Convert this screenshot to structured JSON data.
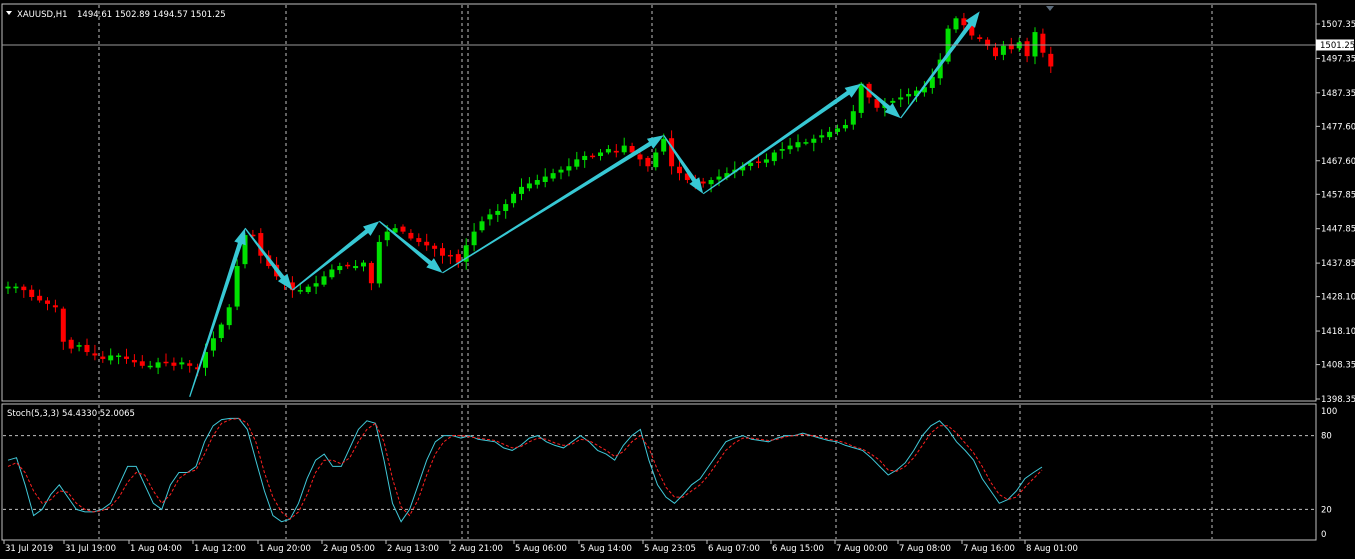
{
  "chart_data": {
    "type": "candlestick",
    "symbol_header": "XAUUSD,H1",
    "ohlc_header": "1494.61 1502.89 1494.57 1501.25",
    "current_price_label": "1501.25",
    "current_price": 1501.25,
    "price_axis": {
      "ylim": [
        1398.35,
        1512.0
      ],
      "ticks": [
        "1507.35",
        "1497.35",
        "1487.35",
        "1477.60",
        "1467.60",
        "1457.85",
        "1447.85",
        "1437.85",
        "1428.10",
        "1418.10",
        "1408.35",
        "1398.35"
      ]
    },
    "time_axis": {
      "labels": [
        "31 Jul 2019",
        "31 Jul 19:00",
        "1 Aug 04:00",
        "1 Aug 12:00",
        "1 Aug 20:00",
        "2 Aug 05:00",
        "2 Aug 13:00",
        "2 Aug 21:00",
        "5 Aug 06:00",
        "5 Aug 14:00",
        "5 Aug 23:05",
        "6 Aug 07:00",
        "6 Aug 15:00",
        "7 Aug 00:00",
        "7 Aug 08:00",
        "7 Aug 16:00",
        "8 Aug 01:00"
      ]
    },
    "colors": {
      "background": "#000000",
      "bull": "#00e000",
      "bear": "#ff0000",
      "grid": "#c0c0c0",
      "arrow": "#37c8d4",
      "stoch_main": "#40c8d8",
      "stoch_signal": "#ff2020",
      "text": "#ffffff"
    },
    "price_path": [
      1431,
      1431,
      1430,
      1428,
      1427,
      1426,
      1425,
      1415,
      1413,
      1414,
      1412,
      1411,
      1410,
      1411,
      1411,
      1410,
      1409,
      1408,
      1408,
      1409,
      1409,
      1408,
      1409,
      1408,
      1407,
      1412,
      1416,
      1420,
      1425,
      1437,
      1446,
      1446,
      1440,
      1437,
      1434,
      1432,
      1430,
      1430,
      1431,
      1432,
      1434,
      1436,
      1437,
      1437,
      1437,
      1438,
      1432,
      1444,
      1447,
      1448,
      1447,
      1445,
      1444,
      1443,
      1442,
      1440,
      1440,
      1438,
      1443,
      1447,
      1450,
      1452,
      1453,
      1455,
      1458,
      1460,
      1461,
      1462,
      1463,
      1464,
      1465,
      1466,
      1468,
      1469,
      1469,
      1470,
      1471,
      1470,
      1472,
      1470,
      1468,
      1466,
      1470,
      1474,
      1466,
      1464,
      1462,
      1461,
      1461,
      1462,
      1463,
      1464,
      1465,
      1466,
      1467,
      1467,
      1468,
      1470,
      1471,
      1472,
      1473,
      1473,
      1474,
      1475,
      1476,
      1477,
      1478,
      1482,
      1490,
      1486,
      1483,
      1484,
      1485,
      1486,
      1487,
      1488,
      1489,
      1492,
      1497,
      1506,
      1509,
      1507,
      1504,
      1503,
      1501,
      1498,
      1501,
      1500,
      1502,
      1498,
      1505,
      1499,
      1495
    ],
    "trend_arrows": [
      {
        "from": [
          23,
          1399
        ],
        "to": [
          30,
          1448
        ]
      },
      {
        "from": [
          30,
          1448
        ],
        "to": [
          36,
          1430
        ]
      },
      {
        "from": [
          36,
          1430
        ],
        "to": [
          47,
          1450
        ]
      },
      {
        "from": [
          47,
          1450
        ],
        "to": [
          55,
          1435
        ]
      },
      {
        "from": [
          55,
          1435
        ],
        "to": [
          83,
          1475
        ]
      },
      {
        "from": [
          83,
          1475
        ],
        "to": [
          88,
          1458
        ]
      },
      {
        "from": [
          88,
          1458
        ],
        "to": [
          108,
          1490
        ]
      },
      {
        "from": [
          108,
          1490
        ],
        "to": [
          113,
          1480
        ]
      },
      {
        "from": [
          113,
          1480
        ],
        "to": [
          123,
          1511
        ]
      }
    ],
    "stochastic": {
      "label": "Stoch(5,3,3) 54.4330 52.0065",
      "ylim": [
        0,
        100
      ],
      "levels": [
        "100",
        "80",
        "20",
        "0"
      ],
      "level_values": [
        80,
        20
      ],
      "k": [
        60,
        62,
        40,
        15,
        20,
        32,
        40,
        30,
        20,
        18,
        18,
        20,
        25,
        40,
        55,
        55,
        40,
        25,
        20,
        40,
        50,
        50,
        55,
        75,
        88,
        93,
        94,
        94,
        85,
        60,
        35,
        15,
        10,
        12,
        25,
        45,
        60,
        65,
        55,
        55,
        70,
        85,
        92,
        90,
        60,
        25,
        10,
        20,
        40,
        60,
        75,
        80,
        80,
        78,
        80,
        77,
        76,
        75,
        70,
        68,
        72,
        78,
        80,
        75,
        72,
        70,
        75,
        80,
        75,
        68,
        65,
        60,
        72,
        80,
        85,
        60,
        40,
        30,
        25,
        32,
        40,
        45,
        55,
        65,
        75,
        78,
        80,
        77,
        76,
        75,
        78,
        80,
        80,
        82,
        80,
        78,
        76,
        75,
        72,
        70,
        68,
        62,
        55,
        48,
        52,
        58,
        68,
        80,
        88,
        92,
        85,
        75,
        68,
        60,
        45,
        35,
        25,
        28,
        35,
        45,
        50,
        54.4
      ],
      "d": [
        55,
        58,
        50,
        35,
        25,
        28,
        35,
        34,
        25,
        20,
        18,
        19,
        22,
        30,
        42,
        50,
        48,
        35,
        25,
        32,
        45,
        50,
        52,
        65,
        80,
        90,
        93,
        94,
        90,
        75,
        50,
        30,
        18,
        12,
        18,
        32,
        50,
        60,
        60,
        57,
        62,
        75,
        85,
        90,
        75,
        45,
        22,
        15,
        28,
        48,
        65,
        75,
        80,
        80,
        79,
        78,
        77,
        76,
        73,
        70,
        71,
        75,
        78,
        77,
        74,
        72,
        73,
        77,
        76,
        72,
        68,
        63,
        67,
        75,
        80,
        70,
        52,
        38,
        30,
        30,
        35,
        40,
        48,
        58,
        68,
        74,
        78,
        78,
        77,
        76,
        77,
        79,
        80,
        81,
        80,
        79,
        77,
        76,
        74,
        71,
        69,
        65,
        60,
        52,
        51,
        55,
        62,
        72,
        82,
        88,
        88,
        82,
        74,
        66,
        55,
        42,
        32,
        28,
        30,
        38,
        45,
        52.0
      ]
    }
  }
}
